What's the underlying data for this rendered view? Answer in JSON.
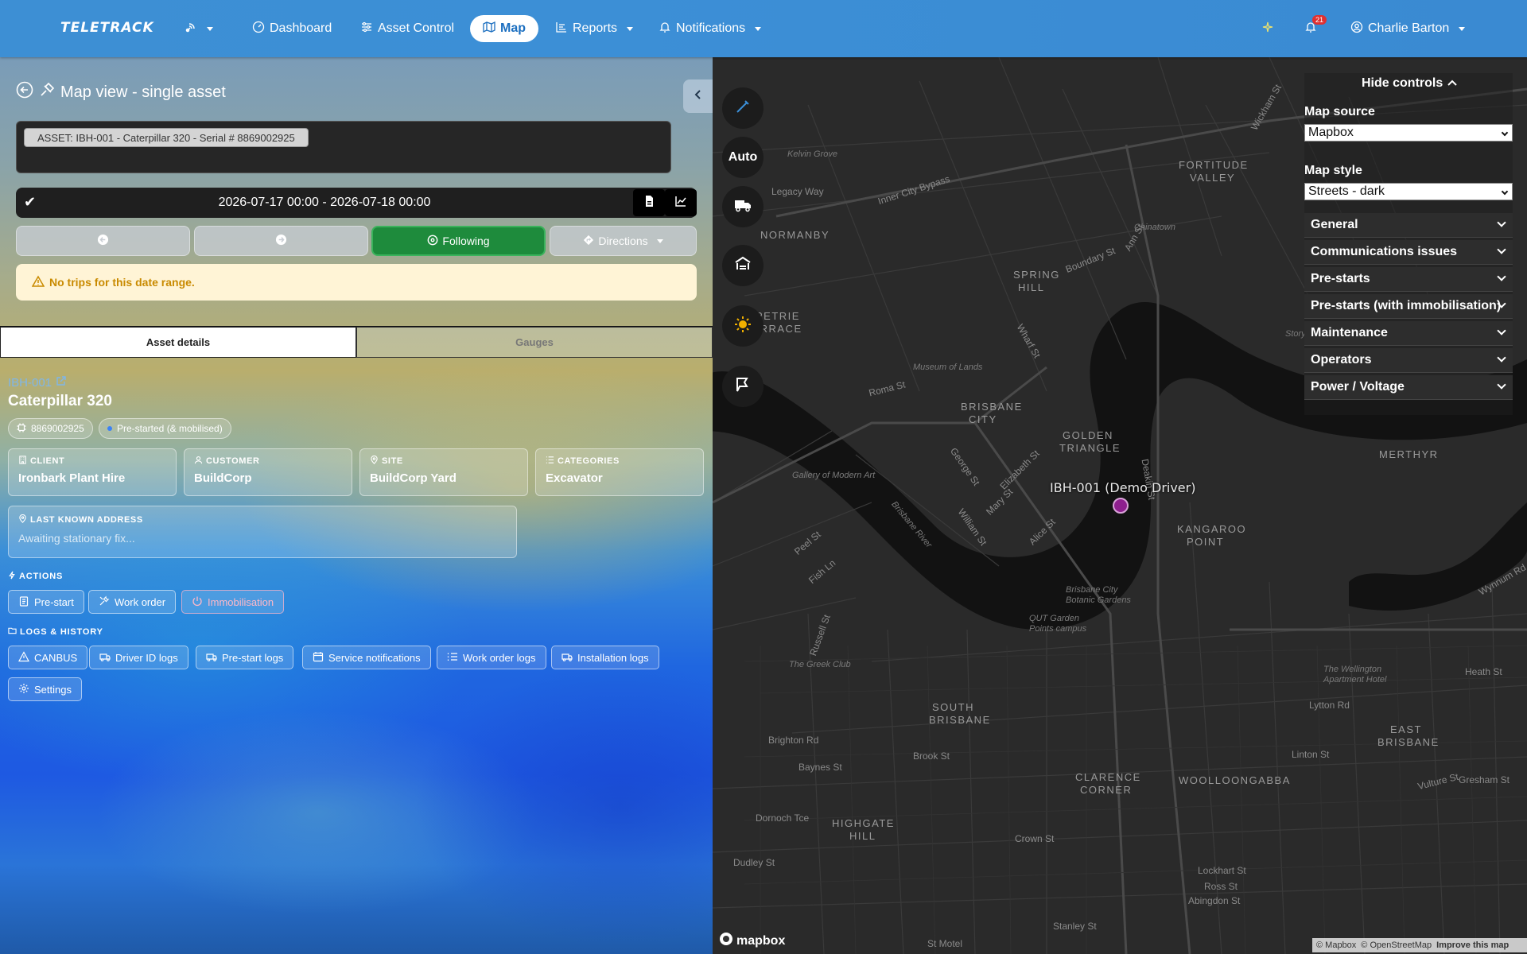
{
  "nav": {
    "brand": "TELETRACK",
    "items": [
      {
        "label": "Dashboard"
      },
      {
        "label": "Asset Control"
      },
      {
        "label": "Map"
      },
      {
        "label": "Reports"
      },
      {
        "label": "Notifications"
      }
    ],
    "notification_count": "21",
    "user": "Charlie Barton"
  },
  "panel": {
    "title": "Map view - single asset",
    "asset_chip": "ASSET: IBH-001 - Caterpillar 320 - Serial # 8869002925",
    "date_range": "2026-07-17 00:00 - 2026-07-18 00:00",
    "following_label": "Following",
    "directions_label": "Directions",
    "alert": "No trips for this date range.",
    "tabs": [
      "Asset details",
      "Gauges"
    ]
  },
  "asset": {
    "id": "IBH-001",
    "name": "Caterpillar 320",
    "serial": "8869002925",
    "status": "Pre-started (& mobilised)",
    "client_label": "CLIENT",
    "client": "Ironbark Plant Hire",
    "customer_label": "CUSTOMER",
    "customer": "BuildCorp",
    "site_label": "SITE",
    "site": "BuildCorp Yard",
    "categories_label": "CATEGORIES",
    "categories": "Excavator",
    "address_label": "LAST KNOWN ADDRESS",
    "address": "Awaiting stationary fix..."
  },
  "actions": {
    "label": "ACTIONS",
    "items": [
      "Pre-start",
      "Work order",
      "Immobilisation"
    ]
  },
  "logs": {
    "label": "LOGS & HISTORY",
    "items": [
      "CANBUS",
      "Driver ID logs",
      "Pre-start logs",
      "Service notifications",
      "Work order logs",
      "Installation logs",
      "Settings"
    ]
  },
  "map": {
    "auto_label": "Auto",
    "marker_label": "IBH-001 (Demo Driver)",
    "hide_controls": "Hide controls",
    "map_source_label": "Map source",
    "map_source": "Mapbox",
    "map_style_label": "Map style",
    "map_style": "Streets - dark",
    "accordions": [
      "General",
      "Communications issues",
      "Pre-starts",
      "Pre-starts (with immobilisation)",
      "Maintenance",
      "Operators",
      "Power / Voltage"
    ],
    "logo": "mapbox",
    "attribution": [
      "© Mapbox",
      "© OpenStreetMap",
      "Improve this map"
    ],
    "labels": {
      "fortitude": "FORTITUDE",
      "valley": "VALLEY",
      "spring": "SPRING",
      "hill": "HILL",
      "petrie": "PETRIE",
      "terrace": "TERRACE",
      "brisbane": "BRISBANE",
      "city": "CITY",
      "golden": "GOLDEN",
      "triangle": "TRIANGLE",
      "kangaroo": "KANGAROO",
      "point": "POINT",
      "south": "SOUTH",
      "sbrisbane": "BRISBANE",
      "east": "EAST",
      "ebrisbane": "BRISBANE",
      "woolloongabba": "WOOLLOONGABBA",
      "clarence": "CLARENCE",
      "corner": "CORNER",
      "highgate": "HIGHGATE",
      "hhill": "HILL",
      "merthyr": "MERTHYR",
      "normanby": "NORMANBY",
      "inner_city_bypass": "Inner City Bypass",
      "legacy_way": "Legacy Way",
      "boundary_st": "Boundary St",
      "roma_st": "Roma St",
      "brisbane_river": "Brisbane River",
      "story_bridge": "Story Bridge",
      "vulture_st": "Vulture St",
      "gresham_st": "Gresham St",
      "stanley_st": "Stanley St",
      "lytton_rd": "Lytton Rd",
      "heath_st": "Heath St",
      "brighton_rd": "Brighton Rd",
      "dornoch_tce": "Dornoch Tce",
      "dudley_st": "Dudley St",
      "ann_st": "Ann St",
      "wickham_st": "Wickham St",
      "wharf_st": "Wharf St",
      "mary_st": "Mary St",
      "alice_st": "Alice St",
      "george_st": "George St",
      "william_st": "William St",
      "elizabeth_st": "Elizabeth St",
      "gallery": "Gallery of Modern Art",
      "kelvin_grove": "Kelvin Grove",
      "chinatown": "Chinatown",
      "museum_lands": "Museum of Lands",
      "greek_club": "The Greek Club",
      "brisbane_botanic": "Brisbane City Botanic Gardens",
      "qut": "QUT Garden Points campus",
      "wynnum_rd": "Wynnum Rd",
      "lockhart_st": "Lockhart St",
      "ross_st": "Ross St",
      "abingdon_st": "Abingdon St",
      "crown_st": "Crown St",
      "brook_st": "Brook St",
      "baynes_st": "Baynes St",
      "linton_st": "Linton St",
      "peel_st": "Peel St",
      "fish_ln": "Fish Ln",
      "russell_st": "Russell St",
      "deakin_st": "Deakin St",
      "st_motel": "St Motel",
      "ahp": "The Wellington Apartment Hotel"
    }
  },
  "colors": {
    "nav_bg": "#3d8fd4",
    "following": "#1e8b3c",
    "alert_bg": "#fff4d6",
    "alert_text": "#c98a00",
    "marker": "#8e1f8e",
    "danger": "#ffb8c8"
  }
}
